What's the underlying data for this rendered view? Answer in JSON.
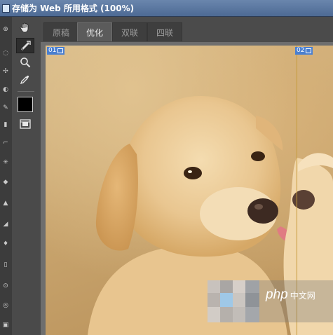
{
  "window": {
    "title": "存储为 Web 所用格式 (100%)"
  },
  "tabs": [
    {
      "label": "原稿",
      "active": false
    },
    {
      "label": "优化",
      "active": true
    },
    {
      "label": "双联",
      "active": false
    },
    {
      "label": "四联",
      "active": false
    }
  ],
  "tools": [
    {
      "name": "hand-tool",
      "icon": "hand-icon"
    },
    {
      "name": "slice-select-tool",
      "icon": "slice-select-icon",
      "active": true
    },
    {
      "name": "zoom-tool",
      "icon": "zoom-icon"
    },
    {
      "name": "eyedropper-tool",
      "icon": "eyedropper-icon"
    },
    {
      "name": "eyedropper-color",
      "color": "#000000"
    },
    {
      "name": "toggle-slices-visibility",
      "icon": "slices-visibility-icon"
    }
  ],
  "slices": [
    {
      "label": "01"
    },
    {
      "label": "02"
    }
  ],
  "watermark": {
    "brand": "php",
    "suffix": "中文网"
  },
  "colors": {
    "titlebar": "#5a779f",
    "panel": "#4a4a4a",
    "slice_label": "#4a7fd0",
    "slice_line": "#c69a3a"
  }
}
